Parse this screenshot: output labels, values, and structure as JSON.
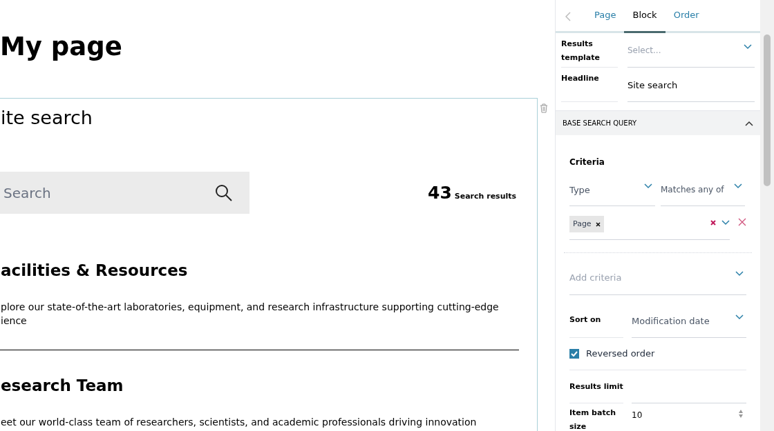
{
  "page": {
    "title": "My page",
    "block": {
      "headline": "ite search",
      "search_placeholder": "Search",
      "results_count": "43",
      "results_label": "Search results",
      "results": [
        {
          "title": "acilities & Resources",
          "description": [
            "plore our state-of-the-art laboratories, equipment, and research infrastructure supporting cutting-edge",
            "ience"
          ]
        },
        {
          "title": "esearch Team",
          "description": [
            "eet our world-class team of researchers, scientists, and academic professionals driving innovation"
          ]
        }
      ]
    }
  },
  "sidebar": {
    "tabs": [
      {
        "label": "Page",
        "selected": false
      },
      {
        "label": "Block",
        "selected": true
      },
      {
        "label": "Order",
        "selected": false
      }
    ],
    "fields": [
      {
        "label": "Results template",
        "placeholder": "Select..."
      },
      {
        "label": "Headline",
        "value": "Site search"
      }
    ],
    "section": {
      "title": "BASE SEARCH QUERY",
      "expanded": true,
      "criteria_label": "Criteria",
      "criterion": {
        "field": "Type",
        "operator": "Matches any of",
        "tags": [
          "Page"
        ]
      },
      "add_placeholder": "Add criteria",
      "sort_label": "Sort on",
      "sort_value": "Modification date",
      "reversed": {
        "label": "Reversed order",
        "checked": true
      },
      "limit_label": "Results limit",
      "batch_label": "Item batch size",
      "batch_value": "10"
    }
  }
}
